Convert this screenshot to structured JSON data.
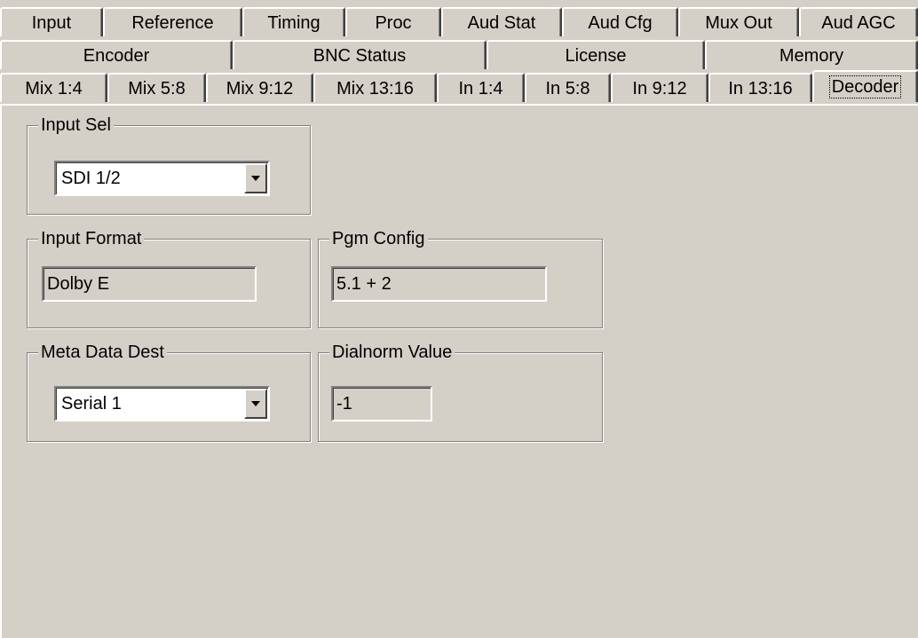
{
  "tabs": {
    "row1": [
      "Input",
      "Reference",
      "Timing",
      "Proc",
      "Aud Stat",
      "Aud Cfg",
      "Mux Out",
      "Aud AGC"
    ],
    "row2": [
      "Encoder",
      "BNC Status",
      "License",
      "Memory"
    ],
    "row3": [
      "Mix 1:4",
      "Mix 5:8",
      "Mix 9:12",
      "Mix 13:16",
      "In 1:4",
      "In 5:8",
      "In 9:12",
      "In 13:16",
      "Decoder"
    ],
    "active": "Decoder"
  },
  "decoder": {
    "input_sel": {
      "label": "Input Sel",
      "value": "SDI 1/2"
    },
    "input_format": {
      "label": "Input Format",
      "value": "Dolby E"
    },
    "pgm_config": {
      "label": "Pgm Config",
      "value": "5.1 + 2"
    },
    "meta_data_dest": {
      "label": "Meta Data Dest",
      "value": "Serial 1"
    },
    "dialnorm": {
      "label": "Dialnorm Value",
      "value": "-1"
    }
  },
  "icons": {
    "dropdown": "chevron-down-icon"
  }
}
